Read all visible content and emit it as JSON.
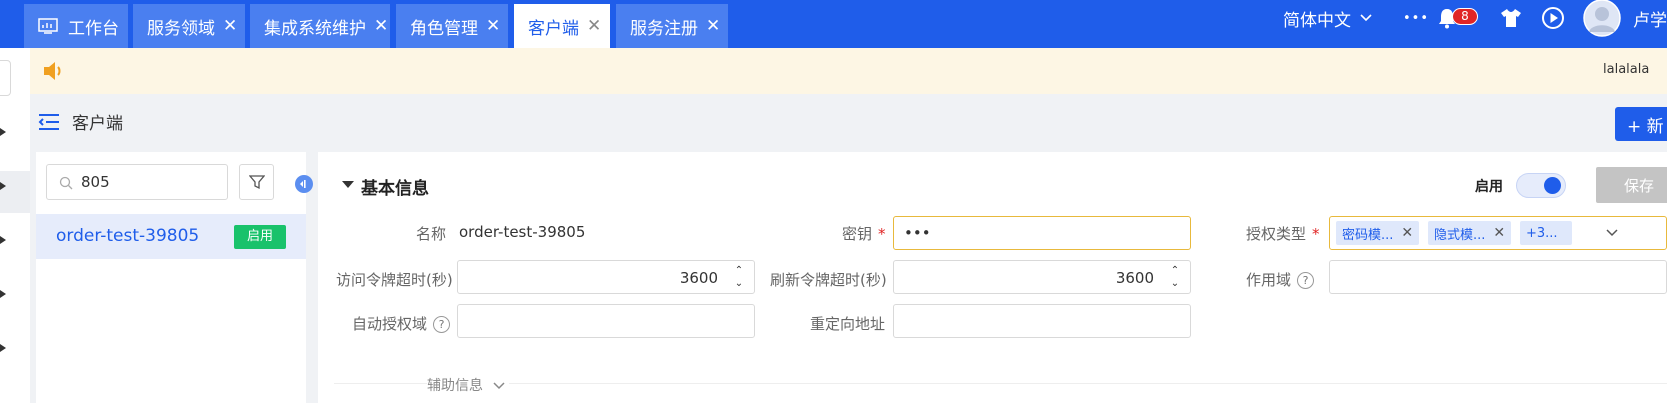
{
  "tabs": [
    {
      "label": "工作台",
      "closable": false,
      "active": false
    },
    {
      "label": "服务领域",
      "closable": true,
      "active": false
    },
    {
      "label": "集成系统维护",
      "closable": true,
      "active": false
    },
    {
      "label": "角色管理",
      "closable": true,
      "active": false
    },
    {
      "label": "客户端",
      "closable": true,
      "active": true
    },
    {
      "label": "服务注册",
      "closable": true,
      "active": false
    }
  ],
  "topbar": {
    "language": "简体中文",
    "more": "•••",
    "notification_count": "8",
    "user_name": "卢学"
  },
  "notice": {
    "text": "lalalala"
  },
  "page": {
    "title": "客户端",
    "new_button": "+ 新"
  },
  "list": {
    "search_value": "805",
    "items": [
      {
        "name": "order-test-39805",
        "status": "启用"
      }
    ]
  },
  "form": {
    "section_title": "基本信息",
    "enable_label": "启用",
    "enabled": true,
    "save_label": "保存",
    "name_label": "名称",
    "name_value": "order-test-39805",
    "secret_label": "密钥",
    "secret_value": "•••",
    "grant_label": "授权类型",
    "grant_chips": [
      "密码模...",
      "隐式模...",
      "+3..."
    ],
    "access_timeout_label": "访问令牌超时(秒)",
    "access_timeout_value": "3600",
    "refresh_timeout_label": "刷新令牌超时(秒)",
    "refresh_timeout_value": "3600",
    "scope_label": "作用域",
    "auto_scope_label": "自动授权域",
    "redirect_label": "重定向地址",
    "aux_label": "辅助信息"
  },
  "colors": {
    "primary": "#1f5dea",
    "success": "#19c26b",
    "notice_bg": "#fdf6e4",
    "badge": "#e02525"
  }
}
